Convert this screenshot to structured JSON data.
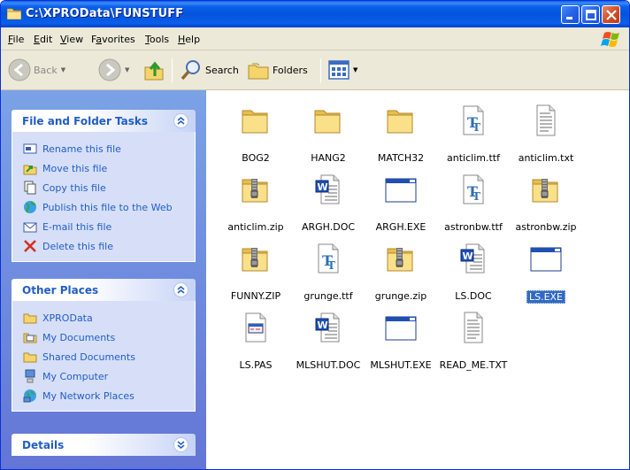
{
  "window": {
    "title": "C:\\XPROData\\FUNSTUFF"
  },
  "menu": [
    {
      "key": "F",
      "rest": "ile"
    },
    {
      "key": "E",
      "rest": "dit"
    },
    {
      "key": "V",
      "rest": "iew"
    },
    {
      "key": "F",
      "rest": "avorites",
      "pre": ""
    },
    {
      "key": "T",
      "rest": "ools"
    },
    {
      "key": "H",
      "rest": "elp"
    }
  ],
  "toolbar": {
    "back": "Back",
    "search": "Search",
    "folders": "Folders"
  },
  "tasks": {
    "title": "File and Folder Tasks",
    "items": [
      "Rename this file",
      "Move this file",
      "Copy this file",
      "Publish this file to the Web",
      "E-mail this file",
      "Delete this file"
    ]
  },
  "places": {
    "title": "Other Places",
    "items": [
      "XPROData",
      "My Documents",
      "Shared Documents",
      "My Computer",
      "My Network Places"
    ]
  },
  "details": {
    "title": "Details"
  },
  "files": [
    {
      "name": "BOG2",
      "type": "folder"
    },
    {
      "name": "HANG2",
      "type": "folder"
    },
    {
      "name": "MATCH32",
      "type": "folder"
    },
    {
      "name": "anticlim.ttf",
      "type": "ttf"
    },
    {
      "name": "anticlim.txt",
      "type": "txt"
    },
    {
      "name": "anticlim.zip",
      "type": "zip"
    },
    {
      "name": "ARGH.DOC",
      "type": "doc"
    },
    {
      "name": "ARGH.EXE",
      "type": "exe"
    },
    {
      "name": "astronbw.ttf",
      "type": "ttf"
    },
    {
      "name": "astronbw.zip",
      "type": "zip"
    },
    {
      "name": "FUNNY.ZIP",
      "type": "zip"
    },
    {
      "name": "grunge.ttf",
      "type": "ttf"
    },
    {
      "name": "grunge.zip",
      "type": "zip"
    },
    {
      "name": "LS.DOC",
      "type": "doc"
    },
    {
      "name": "LS.EXE",
      "type": "exe",
      "selected": true
    },
    {
      "name": "LS.PAS",
      "type": "pas"
    },
    {
      "name": "MLSHUT.DOC",
      "type": "doc"
    },
    {
      "name": "MLSHUT.EXE",
      "type": "exe"
    },
    {
      "name": "READ_ME.TXT",
      "type": "txt"
    }
  ]
}
